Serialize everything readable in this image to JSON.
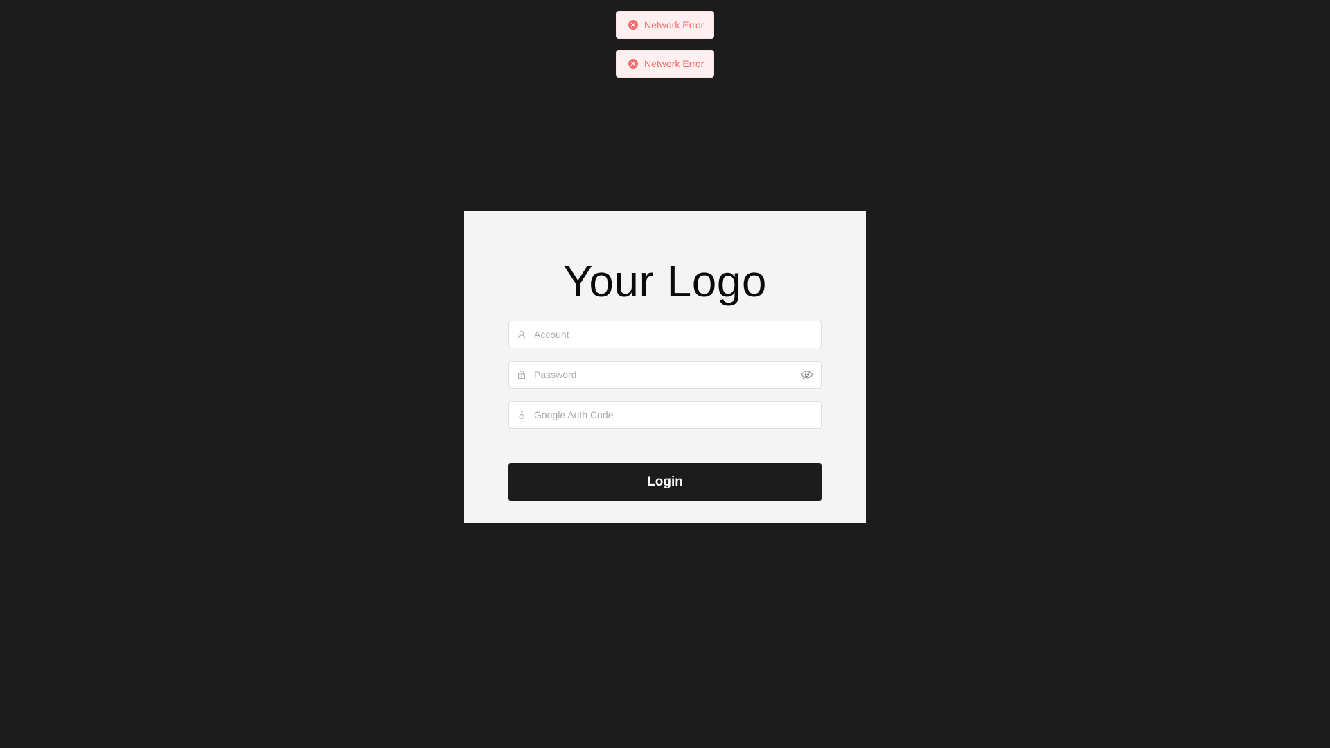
{
  "toasts": [
    {
      "message": "Network Error",
      "type": "error",
      "icon": "error-circle-icon"
    },
    {
      "message": "Network Error",
      "type": "error",
      "icon": "error-circle-icon"
    }
  ],
  "login": {
    "logo_text": "Your Logo",
    "account": {
      "placeholder": "Account",
      "value": "",
      "icon": "user-icon"
    },
    "password": {
      "placeholder": "Password",
      "value": "",
      "icon": "lock-icon",
      "toggle_icon": "eye-off-icon"
    },
    "google_auth": {
      "placeholder": "Google Auth Code",
      "value": "",
      "icon": "key-icon"
    },
    "submit_label": "Login"
  },
  "colors": {
    "background": "#1c1c1c",
    "card": "#f4f4f4",
    "error_text": "#f56c6c",
    "error_bg": "#fef0f0",
    "button": "#1c1c1c"
  }
}
